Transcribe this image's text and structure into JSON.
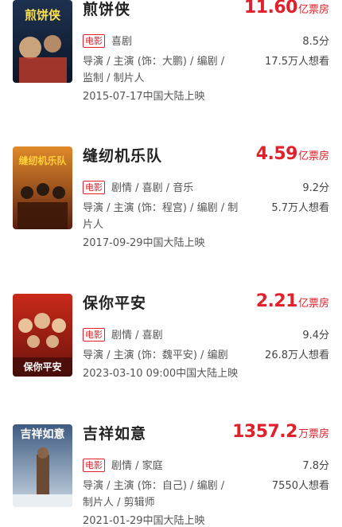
{
  "movies": [
    {
      "title": "煎饼侠",
      "box_num": "11.60",
      "box_unit": "亿票房",
      "tag": "电影",
      "genres": "喜剧",
      "score": "8.5分",
      "credits_1": "导演 / 主演 (饰：大鹏) / 编剧 /",
      "credits_2": "监制 / 制片人",
      "want": "17.5万人想看",
      "release": "2015-07-17中国大陆上映",
      "poster_text": "煎饼侠",
      "poster_colors": [
        "#1d3150",
        "#c43c2b"
      ]
    },
    {
      "title": "缝纫机乐队",
      "box_num": "4.59",
      "box_unit": "亿票房",
      "tag": "电影",
      "genres": "剧情 / 喜剧 / 音乐",
      "score": "9.2分",
      "credits_1": "导演 / 主演 (饰：程宫) / 编剧 / 制",
      "credits_2": "片人",
      "want": "5.7万人想看",
      "release": "2017-09-29中国大陆上映",
      "poster_text": "缝纫机乐队",
      "poster_colors": [
        "#5a1e0f",
        "#e0892b"
      ]
    },
    {
      "title": "保你平安",
      "box_num": "2.21",
      "box_unit": "亿票房",
      "tag": "电影",
      "genres": "剧情 / 喜剧",
      "score": "9.4分",
      "credits_1": "导演 / 主演 (饰：魏平安) / 编剧",
      "credits_2": "",
      "want": "26.8万人想看",
      "release": "2023-03-10 09:00中国大陆上映",
      "poster_text": "保你平安",
      "poster_colors": [
        "#8a1a12",
        "#f0c040"
      ]
    },
    {
      "title": "吉祥如意",
      "box_num": "1357.2",
      "box_unit": "万票房",
      "tag": "电影",
      "genres": "剧情 / 家庭",
      "score": "7.8分",
      "credits_1": "导演 / 主演 (饰：自己) / 编剧 /",
      "credits_2": "制片人 / 剪辑师",
      "want": "7550人想看",
      "release": "2021-01-29中国大陆上映",
      "poster_text": "吉祥如意",
      "poster_colors": [
        "#3d5a80",
        "#c9d6e3"
      ]
    }
  ]
}
